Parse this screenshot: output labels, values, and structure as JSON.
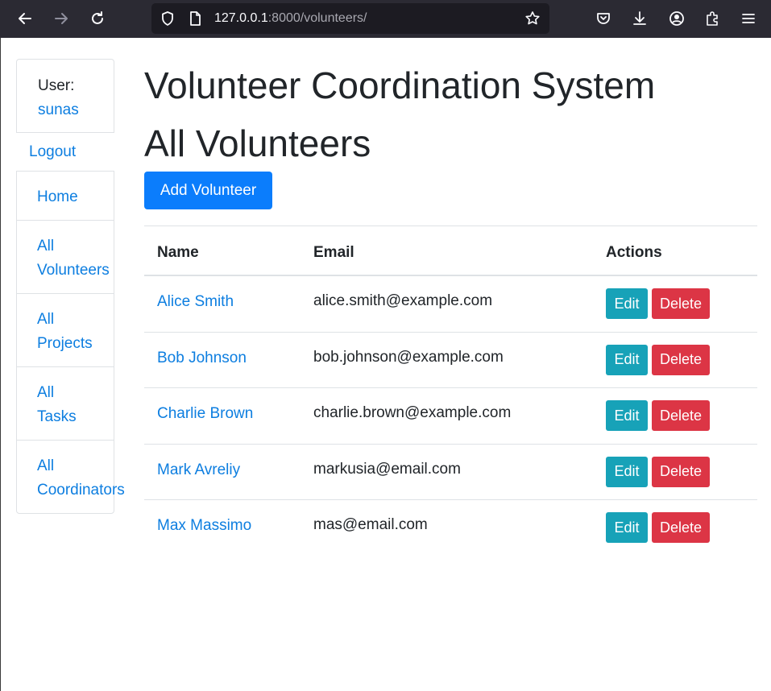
{
  "browser": {
    "url_host": "127.0.0.1",
    "url_rest": ":8000/volunteers/",
    "icons": [
      "back-arrow-icon",
      "forward-arrow-icon",
      "reload-icon",
      "shield-icon",
      "page-icon",
      "bookmark-star-icon",
      "pocket-icon",
      "download-icon",
      "account-icon",
      "extensions-icon",
      "menu-icon"
    ]
  },
  "sidebar": {
    "user_label": "User:",
    "username": "sunas",
    "logout": "Logout",
    "nav": [
      {
        "label": "Home"
      },
      {
        "label": "All\nVolunteers"
      },
      {
        "label": "All\nProjects"
      },
      {
        "label": "All\nTasks"
      },
      {
        "label": "All\nCoordinators"
      }
    ]
  },
  "main": {
    "title": "Volunteer Coordination System",
    "subtitle": "All Volunteers",
    "add_button": "Add Volunteer",
    "table": {
      "headers": {
        "name": "Name",
        "email": "Email",
        "actions": "Actions"
      },
      "rows": [
        {
          "name": "Alice Smith",
          "email": "alice.smith@example.com"
        },
        {
          "name": "Bob Johnson",
          "email": "bob.johnson@example.com"
        },
        {
          "name": "Charlie Brown",
          "email": "charlie.brown@example.com"
        },
        {
          "name": "Mark Avreliy",
          "email": "markusia@email.com"
        },
        {
          "name": "Max Massimo",
          "email": "mas@email.com"
        }
      ],
      "edit_label": "Edit",
      "delete_label": "Delete"
    }
  },
  "colors": {
    "link": "#0d7ee0",
    "primary": "#0b7dfc",
    "info": "#17a2b8",
    "danger": "#dc3545",
    "chrome": "#2b2a33"
  }
}
